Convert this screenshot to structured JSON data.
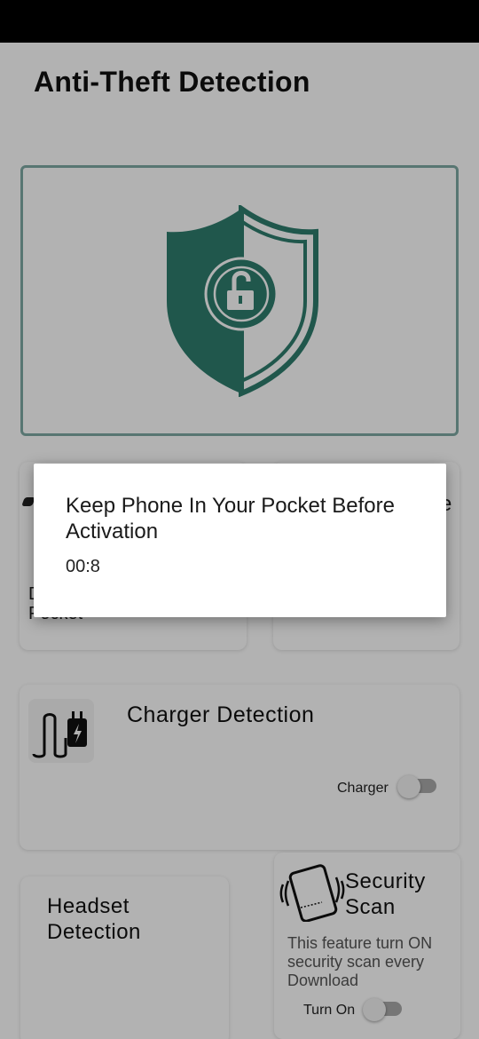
{
  "app": {
    "title": "Anti-Theft Detection"
  },
  "cards": {
    "pocket": {
      "label_left_peek": "D",
      "label_bottom_peek": "Pocket"
    },
    "right": {
      "label_peek": "e"
    },
    "charger": {
      "title": "Charger Detection",
      "toggle_label": "Charger",
      "toggle_on": false
    },
    "headset": {
      "title": "Headset Detection"
    },
    "security": {
      "title": "Security Scan",
      "description": "This feature turn ON security scan every Download",
      "toggle_label": "Turn On",
      "toggle_on": false
    }
  },
  "dialog": {
    "message": "Keep Phone In Your Pocket Before Activation",
    "timer": "00:8"
  },
  "colors": {
    "accent": "#2e7d6e",
    "shield_light": "#ffffff",
    "border": "#7fa9a4"
  },
  "icons": {
    "hero": "shield-unlock-icon",
    "charger": "charger-plug-icon",
    "security": "phone-vibrate-icon"
  }
}
